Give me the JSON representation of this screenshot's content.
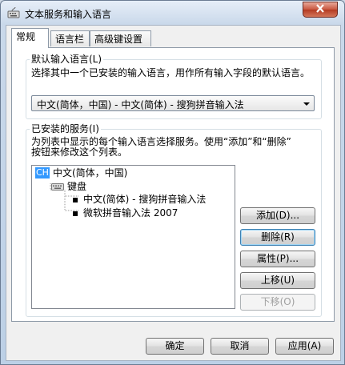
{
  "window": {
    "title": "文本服务和输入语言"
  },
  "tabs": [
    {
      "label": "常规"
    },
    {
      "label": "语言栏"
    },
    {
      "label": "高级键设置"
    }
  ],
  "default_language": {
    "group_label": "默认输入语言(L)",
    "description": "选择其中一个已安装的输入语言，用作所有输入字段的默认语言。",
    "selected": "中文(简体，中国) - 中文(简体) - 搜狗拼音输入法"
  },
  "installed_services": {
    "group_label": "已安装的服务(I)",
    "description_line1": "为列表中显示的每个输入语言选择服务。使用“添加”和“删除”",
    "description_line2": "按钮来修改这个列表。",
    "tree": {
      "language_badge": "CH",
      "language": "中文(简体，中国)",
      "category": "键盘",
      "items": [
        "中文(简体) - 搜狗拼音输入法",
        "微软拼音输入法 2007"
      ]
    },
    "buttons": {
      "add": "添加(D)...",
      "remove": "删除(R)",
      "properties": "属性(P)...",
      "move_up": "上移(U)",
      "move_down": "下移(O)"
    }
  },
  "footer": {
    "ok": "确定",
    "cancel": "取消",
    "apply": "应用(A)"
  },
  "colors": {
    "badge_bg": "#3399ff",
    "focus_border": "#3c7fb1"
  }
}
